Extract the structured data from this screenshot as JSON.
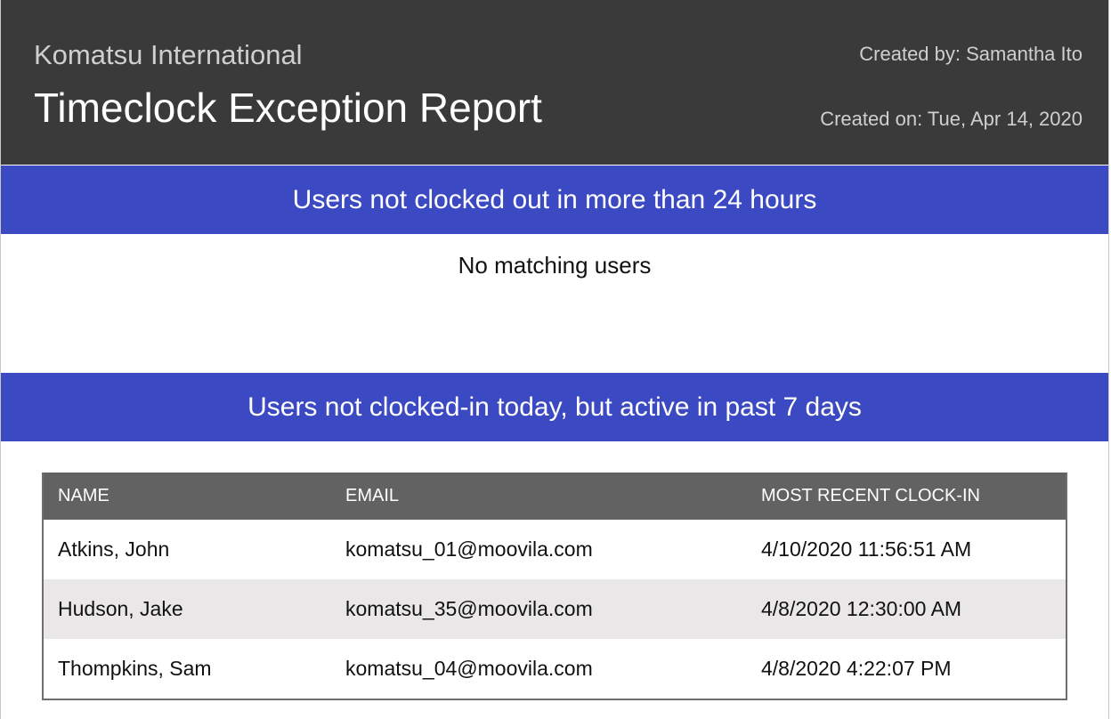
{
  "header": {
    "company": "Komatsu International",
    "title": "Timeclock Exception Report",
    "created_by_label": "Created by:",
    "created_by_value": "Samantha Ito",
    "created_on_label": "Created on:",
    "created_on_value": "Tue, Apr 14, 2020"
  },
  "sections": [
    {
      "title": "Users not clocked out in more than 24 hours",
      "empty_message": "No matching users"
    },
    {
      "title": "Users not clocked-in today, but active in past 7 days",
      "table": {
        "columns": [
          "NAME",
          "EMAIL",
          "MOST RECENT CLOCK-IN"
        ],
        "rows": [
          [
            "Atkins, John",
            "komatsu_01@moovila.com",
            "4/10/2020 11:56:51 AM"
          ],
          [
            "Hudson, Jake",
            "komatsu_35@moovila.com",
            "4/8/2020 12:30:00 AM"
          ],
          [
            "Thompkins, Sam",
            "komatsu_04@moovila.com",
            "4/8/2020 4:22:07 PM"
          ]
        ]
      }
    }
  ],
  "colors": {
    "header_bg": "#3a3a3b",
    "section_bar_bg": "#3b49c2",
    "table_header_bg": "#626262",
    "striped_row_bg": "#e9e7e7"
  }
}
